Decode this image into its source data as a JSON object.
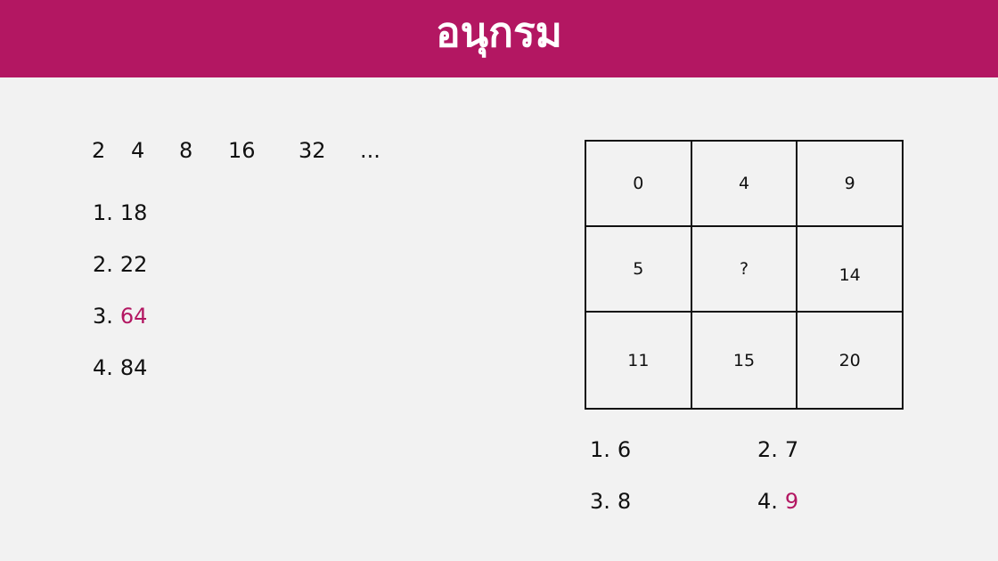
{
  "header": {
    "title": "อนุกรม",
    "color": "#b31762"
  },
  "question1": {
    "sequence": [
      "2",
      "4",
      "8",
      "16",
      "32",
      "..."
    ],
    "options": [
      {
        "num": "1.",
        "value": "18"
      },
      {
        "num": "2.",
        "value": "22"
      },
      {
        "num": "3.",
        "value": "64",
        "correct": true
      },
      {
        "num": "4.",
        "value": "84"
      }
    ]
  },
  "question2": {
    "grid": [
      [
        "0",
        "4",
        "9"
      ],
      [
        "5",
        "?",
        "14"
      ],
      [
        "11",
        "15",
        "20"
      ]
    ],
    "options": [
      {
        "num": "1.",
        "value": "6"
      },
      {
        "num": "2.",
        "value": "7"
      },
      {
        "num": "3.",
        "value": "8"
      },
      {
        "num": "4.",
        "value": "9",
        "correct": true
      }
    ]
  },
  "accent_color": "#b31762"
}
